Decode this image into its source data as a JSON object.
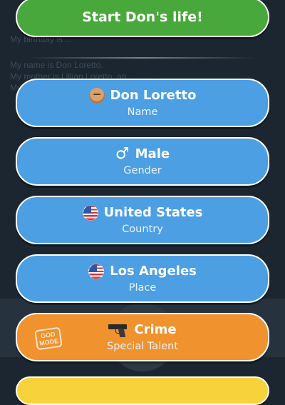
{
  "background": {
    "lines": [
      "My birthday is ...",
      "My name is Don Loretto.",
      "My mother is Lillian Loretto, an ...",
      "My ..."
    ]
  },
  "start_button": {
    "label": "Start Don's life!"
  },
  "options": [
    {
      "icon": "face-icon",
      "value": "Don Loretto",
      "caption": "Name"
    },
    {
      "icon": "male-symbol-icon",
      "value": "Male",
      "caption": "Gender"
    },
    {
      "icon": "us-flag-icon",
      "value": "United States",
      "caption": "Country"
    },
    {
      "icon": "us-flag-icon",
      "value": "Los Angeles",
      "caption": "Place"
    },
    {
      "icon": "pistol-icon",
      "value": "Crime",
      "caption": "Special Talent",
      "badge": "GOD MODE"
    }
  ],
  "colors": {
    "background": "#1c2631",
    "start_button": "#48a83c",
    "option_blue": "#4d9fe3",
    "option_orange": "#f0922d",
    "bottom_button": "#f7d23b",
    "border": "#ffffff"
  }
}
